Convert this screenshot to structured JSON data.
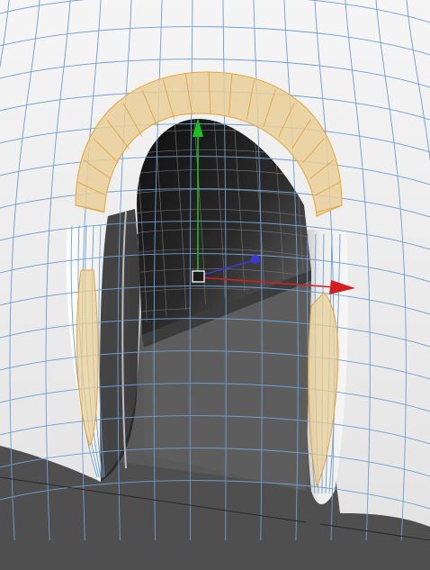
{
  "viewport": {
    "colors": {
      "surface_light": "#f2f2f2",
      "surface_mid": "#d8d8d8",
      "surface_shadow": "#b5b5b5",
      "interior_dark": "#1a1a1a",
      "floor": "#595959",
      "wire": "#6f9fcf",
      "selection_fill": "#e9cf98",
      "selection_edge": "#e6a63b",
      "axis_x": "#d42020",
      "axis_y": "#1ec21e",
      "axis_z": "#3a3ad8"
    },
    "icons": {
      "gizmo": "move-gizmo-icon",
      "pivot": "pivot-box-icon"
    }
  }
}
